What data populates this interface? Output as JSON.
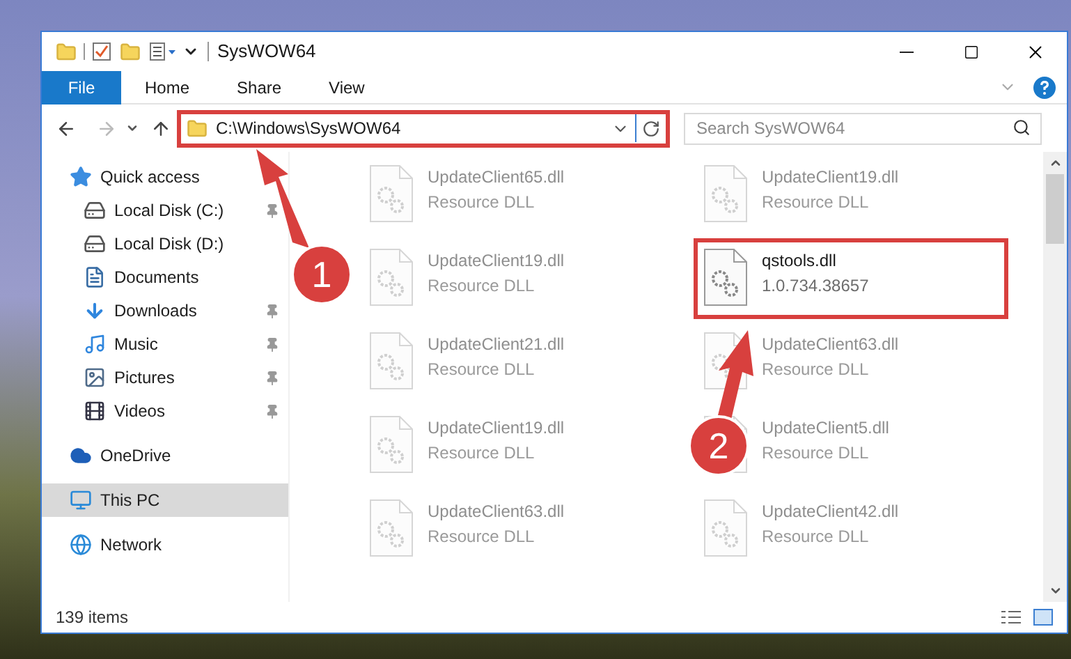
{
  "window": {
    "title": "SysWOW64"
  },
  "ribbon": {
    "tabs": [
      {
        "label": "File",
        "kind": "file"
      },
      {
        "label": "Home",
        "kind": "tab"
      },
      {
        "label": "Share",
        "kind": "tab"
      },
      {
        "label": "View",
        "kind": "tab"
      }
    ]
  },
  "address": {
    "path": "C:\\Windows\\SysWOW64",
    "annotated": true
  },
  "search": {
    "placeholder": "Search SysWOW64"
  },
  "sidebar": {
    "items": [
      {
        "label": "Quick access",
        "kind": "star",
        "selected": false,
        "pinned": false,
        "children": [
          {
            "label": "Local Disk (C:)",
            "kind": "drive",
            "selected": false,
            "pinned": true
          },
          {
            "label": "Local Disk (D:)",
            "kind": "drive",
            "selected": false,
            "pinned": false
          },
          {
            "label": "Documents",
            "kind": "document",
            "selected": false,
            "pinned": false
          },
          {
            "label": "Downloads",
            "kind": "download",
            "selected": false,
            "pinned": true
          },
          {
            "label": "Music",
            "kind": "music",
            "selected": false,
            "pinned": true
          },
          {
            "label": "Pictures",
            "kind": "pictures",
            "selected": false,
            "pinned": true
          },
          {
            "label": "Videos",
            "kind": "videos",
            "selected": false,
            "pinned": true
          }
        ]
      },
      {
        "label": "OneDrive",
        "kind": "cloud",
        "selected": false,
        "pinned": false
      },
      {
        "label": "This PC",
        "kind": "pc",
        "selected": true,
        "pinned": false
      },
      {
        "label": "Network",
        "kind": "network",
        "selected": false,
        "pinned": false
      }
    ]
  },
  "files": [
    {
      "name": "UpdateClient65.dll",
      "detail": "Resource DLL",
      "blurred": true,
      "annotated": false
    },
    {
      "name": "UpdateClient19.dll",
      "detail": "Resource DLL",
      "blurred": true,
      "annotated": false
    },
    {
      "name": "UpdateClient19.dll",
      "detail": "Resource DLL",
      "blurred": true,
      "annotated": false
    },
    {
      "name": "qstools.dll",
      "detail": "1.0.734.38657",
      "blurred": false,
      "annotated": true
    },
    {
      "name": "UpdateClient21.dll",
      "detail": "Resource DLL",
      "blurred": true,
      "annotated": false
    },
    {
      "name": "UpdateClient63.dll",
      "detail": "Resource DLL",
      "blurred": true,
      "annotated": false
    },
    {
      "name": "UpdateClient19.dll",
      "detail": "Resource DLL",
      "blurred": true,
      "annotated": false
    },
    {
      "name": "UpdateClient5.dll",
      "detail": "Resource DLL",
      "blurred": true,
      "annotated": false
    },
    {
      "name": "UpdateClient63.dll",
      "detail": "Resource DLL",
      "blurred": true,
      "annotated": false
    },
    {
      "name": "UpdateClient42.dll",
      "detail": "Resource DLL",
      "blurred": true,
      "annotated": false
    }
  ],
  "status_bar": {
    "count": "139 items"
  },
  "annotations": [
    {
      "label": "1"
    },
    {
      "label": "2"
    }
  ]
}
